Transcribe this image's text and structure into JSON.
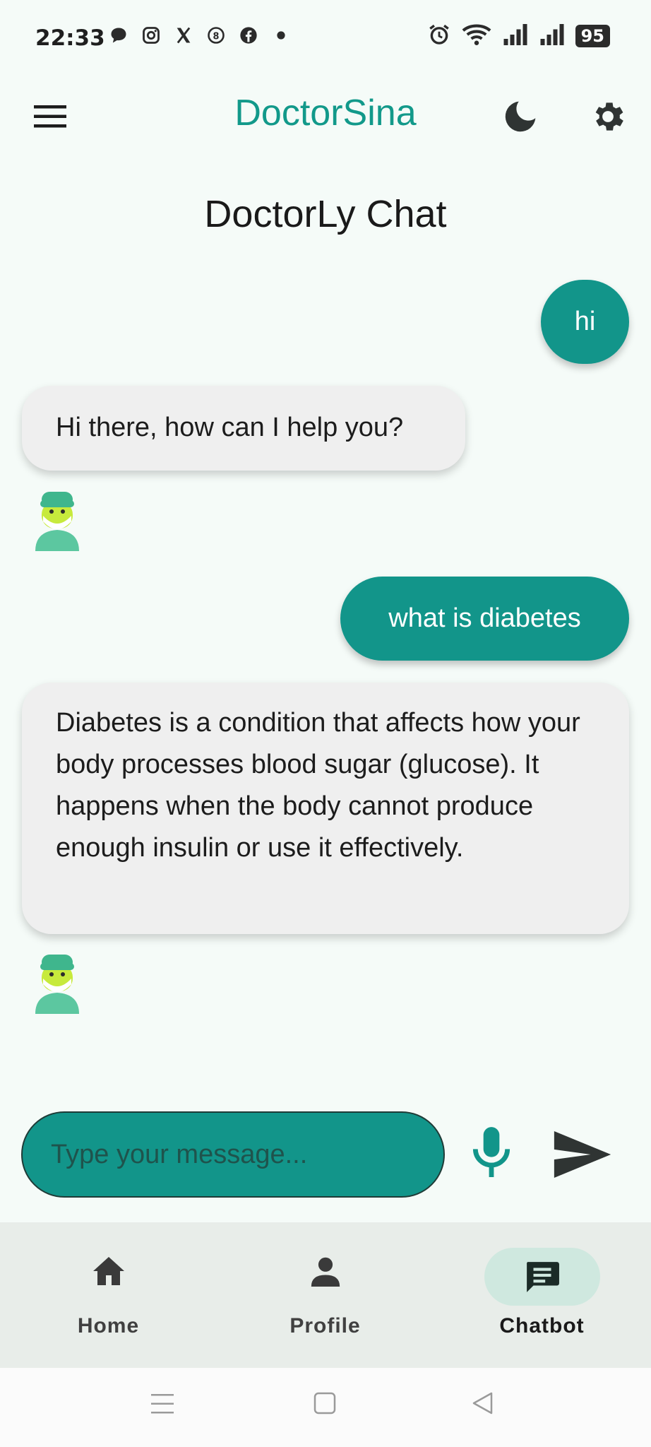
{
  "status_bar": {
    "time": "22:33",
    "battery": "95"
  },
  "app_bar": {
    "title": "DoctorSina"
  },
  "chat": {
    "title": "DoctorLy Chat",
    "messages": [
      {
        "role": "user",
        "text": "hi"
      },
      {
        "role": "bot",
        "text": "Hi there, how can I help you?"
      },
      {
        "role": "user",
        "text": "what is diabetes"
      },
      {
        "role": "bot",
        "text": "Diabetes is a condition that affects how your body processes blood sugar (glucose). It happens when the body cannot produce enough insulin or use it effectively."
      }
    ]
  },
  "input": {
    "placeholder": "Type your message...",
    "value": ""
  },
  "bottom_nav": {
    "items": [
      {
        "label": "Home",
        "icon": "home-icon",
        "active": false
      },
      {
        "label": "Profile",
        "icon": "person-icon",
        "active": false
      },
      {
        "label": "Chatbot",
        "icon": "chat-icon",
        "active": true
      }
    ]
  },
  "colors": {
    "accent": "#12958a",
    "bubble_bot": "#efefef",
    "background": "#f5fbf8"
  }
}
